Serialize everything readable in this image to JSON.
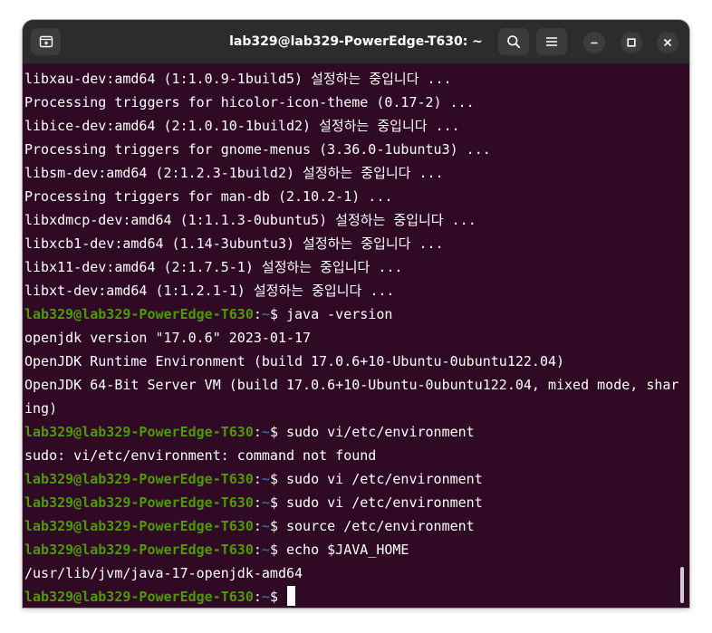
{
  "window": {
    "title": "lab329@lab329-PowerEdge-T630: ~",
    "icons": {
      "new_tab": "new-tab-icon",
      "search": "search-icon",
      "menu": "hamburger-menu-icon",
      "minimize": "minimize-icon",
      "maximize": "maximize-icon",
      "close": "close-icon"
    }
  },
  "colors": {
    "terminal_bg": "#300a24",
    "prompt_green": "#4e9a06",
    "titlebar_bg": "#2c2c2c",
    "text": "#ffffff"
  },
  "terminal": {
    "prompt": {
      "user_host": "lab329@lab329-PowerEdge-T630",
      "path": "~",
      "symbol": "$"
    },
    "lines": [
      {
        "text": "libxau-dev:amd64 (1:1.0.9-1build5) 설정하는 중입니다 ..."
      },
      {
        "text": "Processing triggers for hicolor-icon-theme (0.17-2) ..."
      },
      {
        "text": "libice-dev:amd64 (2:1.0.10-1build2) 설정하는 중입니다 ..."
      },
      {
        "text": "Processing triggers for gnome-menus (3.36.0-1ubuntu3) ..."
      },
      {
        "text": "libsm-dev:amd64 (2:1.2.3-1build2) 설정하는 중입니다 ..."
      },
      {
        "text": "Processing triggers for man-db (2.10.2-1) ..."
      },
      {
        "text": "libxdmcp-dev:amd64 (1:1.1.3-0ubuntu5) 설정하는 중입니다 ..."
      },
      {
        "text": "libxcb1-dev:amd64 (1.14-3ubuntu3) 설정하는 중입니다 ..."
      },
      {
        "text": "libx11-dev:amd64 (2:1.7.5-1) 설정하는 중입니다 ..."
      },
      {
        "text": "libxt-dev:amd64 (1:1.2.1-1) 설정하는 중입니다 ..."
      },
      {
        "cmd": " java -version"
      },
      {
        "text": "openjdk version \"17.0.6\" 2023-01-17"
      },
      {
        "text": "OpenJDK Runtime Environment (build 17.0.6+10-Ubuntu-0ubuntu122.04)"
      },
      {
        "text": "OpenJDK 64-Bit Server VM (build 17.0.6+10-Ubuntu-0ubuntu122.04, mixed mode, shar"
      },
      {
        "text": "ing)"
      },
      {
        "cmd": " sudo vi/etc/environment"
      },
      {
        "text": "sudo: vi/etc/environment: command not found"
      },
      {
        "cmd": " sudo vi /etc/environment"
      },
      {
        "cmd": " sudo vi /etc/environment"
      },
      {
        "cmd": " source /etc/environment"
      },
      {
        "cmd": " echo $JAVA_HOME"
      },
      {
        "text": "/usr/lib/jvm/java-17-openjdk-amd64"
      },
      {
        "cmd": " ",
        "cursor": true
      }
    ]
  }
}
